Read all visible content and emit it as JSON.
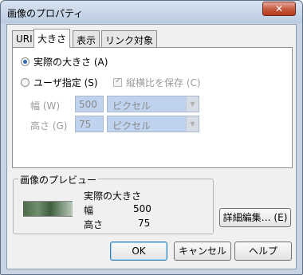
{
  "window": {
    "title": "画像のプロパティ",
    "close_glyph": "✕"
  },
  "tabs": [
    {
      "label": "URI",
      "active": false
    },
    {
      "label": "大きさ",
      "active": true
    },
    {
      "label": "表示",
      "active": false
    },
    {
      "label": "リンク対象",
      "active": false
    }
  ],
  "size": {
    "actual_size_label": "実際の大きさ (A)",
    "user_specified_label": "ユーザ指定 (S)",
    "keep_ratio_label": "縦横比を保存 (C)",
    "width_label": "幅 (W)",
    "width_value": "500",
    "width_unit": "ピクセル",
    "height_label": "高さ (G)",
    "height_value": "75",
    "height_unit": "ピクセル"
  },
  "preview": {
    "title": "画像のプレビュー",
    "actual_size_text": "実際の大きさ",
    "width_label": "幅",
    "width_value": "500",
    "height_label": "高さ",
    "height_value": "75"
  },
  "buttons": {
    "advanced_edit": "詳細編集… (E)",
    "ok": "OK",
    "cancel": "キャンセル",
    "help": "ヘルプ"
  }
}
